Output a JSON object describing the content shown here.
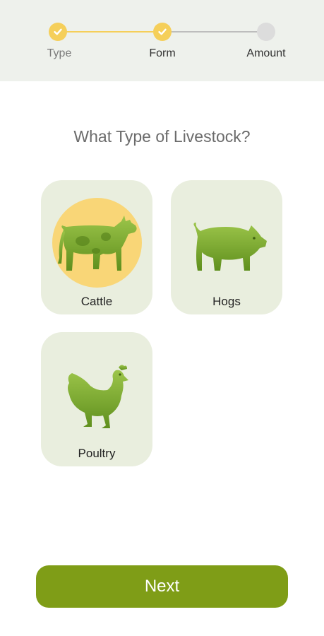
{
  "stepper": {
    "steps": [
      {
        "label": "Type",
        "status": "complete"
      },
      {
        "label": "Form",
        "status": "complete"
      },
      {
        "label": "Amount",
        "status": "pending"
      }
    ]
  },
  "main": {
    "question": "What Type of Livestock?",
    "options": [
      {
        "label": "Cattle",
        "icon": "cow-icon",
        "selected": true
      },
      {
        "label": "Hogs",
        "icon": "pig-icon",
        "selected": false
      },
      {
        "label": "Poultry",
        "icon": "chicken-icon",
        "selected": false
      }
    ]
  },
  "footer": {
    "next_label": "Next"
  },
  "colors": {
    "accent_green": "#7f9d17",
    "animal_green": "#7fae2e",
    "card_bg": "#e9eede",
    "selected_halo": "#f9d677",
    "step_done": "#f5cf5a"
  }
}
